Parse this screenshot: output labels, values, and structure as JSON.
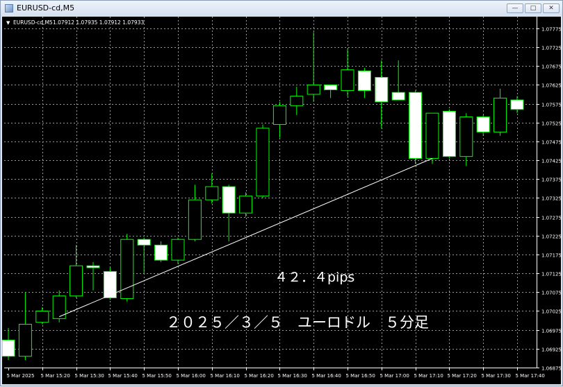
{
  "window": {
    "title": "EURUSD-cd,M5",
    "buttons": {
      "minimize": "—",
      "maximize": "□",
      "close": "✕"
    }
  },
  "chart_info": {
    "marker": "▼",
    "symbol": "EURUSD-cd,M5",
    "ohlc": "1.07912 1.07935 1.07912 1.07933"
  },
  "colors": {
    "background": "#000000",
    "grid": "#9a9a9a",
    "bull_body": "#000000",
    "bear_body": "#ffffff",
    "candle_outline": "#00ff00",
    "trend_line": "#ffffff",
    "text": "#ffffff"
  },
  "annotations": {
    "pips": "４２．４pips",
    "caption": "２０２５／３／５　ユーロドル　５分足"
  },
  "chart_data": {
    "type": "candlestick",
    "ylim": [
      1.06875,
      1.07795
    ],
    "yticks": [
      1.07775,
      1.07725,
      1.07675,
      1.07625,
      1.07575,
      1.07525,
      1.07475,
      1.07425,
      1.07375,
      1.07325,
      1.07275,
      1.07225,
      1.07175,
      1.07125,
      1.07075,
      1.07025,
      1.06975,
      1.06925,
      1.06875
    ],
    "ytick_labels": [
      "1.07775",
      "1.07725",
      "1.07675",
      "1.07625",
      "1.07575",
      "1.07525",
      "1.07475",
      "1.07425",
      "1.07375",
      "1.07325",
      "1.07275",
      "1.07225",
      "1.07175",
      "1.07125",
      "1.07075",
      "1.07025",
      "1.06975",
      "1.06925",
      "1.06875"
    ],
    "xtick_labels": [
      "5 Mar 2025",
      "5 Mar 15:20",
      "5 Mar 15:30",
      "5 Mar 15:40",
      "5 Mar 15:50",
      "5 Mar 16:00",
      "5 Mar 16:10",
      "5 Mar 16:20",
      "5 Mar 16:30",
      "5 Mar 16:40",
      "5 Mar 16:50",
      "5 Mar 17:00",
      "5 Mar 17:10",
      "5 Mar 17:20",
      "5 Mar 17:30",
      "5 Mar 17:40"
    ],
    "candles": [
      {
        "o": 1.06948,
        "h": 1.0698,
        "l": 1.06895,
        "c": 1.06905
      },
      {
        "o": 1.06905,
        "h": 1.07075,
        "l": 1.06895,
        "c": 1.0699
      },
      {
        "o": 1.06995,
        "h": 1.07035,
        "l": 1.0699,
        "c": 1.07025
      },
      {
        "o": 1.07005,
        "h": 1.0708,
        "l": 1.06995,
        "c": 1.07065
      },
      {
        "o": 1.07065,
        "h": 1.072,
        "l": 1.0706,
        "c": 1.07145
      },
      {
        "o": 1.07145,
        "h": 1.07155,
        "l": 1.0708,
        "c": 1.0714
      },
      {
        "o": 1.0713,
        "h": 1.0714,
        "l": 1.07055,
        "c": 1.0706
      },
      {
        "o": 1.07058,
        "h": 1.0723,
        "l": 1.0705,
        "c": 1.07215
      },
      {
        "o": 1.07215,
        "h": 1.0722,
        "l": 1.07125,
        "c": 1.072
      },
      {
        "o": 1.072,
        "h": 1.0721,
        "l": 1.07155,
        "c": 1.0716
      },
      {
        "o": 1.0716,
        "h": 1.0722,
        "l": 1.0715,
        "c": 1.07215
      },
      {
        "o": 1.07215,
        "h": 1.0736,
        "l": 1.0721,
        "c": 1.0732
      },
      {
        "o": 1.0732,
        "h": 1.0739,
        "l": 1.0731,
        "c": 1.07355
      },
      {
        "o": 1.07355,
        "h": 1.0736,
        "l": 1.0721,
        "c": 1.07285
      },
      {
        "o": 1.07285,
        "h": 1.0734,
        "l": 1.07275,
        "c": 1.0733
      },
      {
        "o": 1.0733,
        "h": 1.0752,
        "l": 1.07325,
        "c": 1.0751
      },
      {
        "o": 1.0752,
        "h": 1.0758,
        "l": 1.07485,
        "c": 1.0757
      },
      {
        "o": 1.0757,
        "h": 1.0762,
        "l": 1.07545,
        "c": 1.07595
      },
      {
        "o": 1.076,
        "h": 1.07765,
        "l": 1.0758,
        "c": 1.07625
      },
      {
        "o": 1.07625,
        "h": 1.0762,
        "l": 1.0759,
        "c": 1.07612
      },
      {
        "o": 1.0761,
        "h": 1.0772,
        "l": 1.07595,
        "c": 1.07665
      },
      {
        "o": 1.07662,
        "h": 1.0767,
        "l": 1.0759,
        "c": 1.0761
      },
      {
        "o": 1.07645,
        "h": 1.0769,
        "l": 1.0751,
        "c": 1.0758
      },
      {
        "o": 1.07605,
        "h": 1.0769,
        "l": 1.07585,
        "c": 1.07585
      },
      {
        "o": 1.07605,
        "h": 1.0761,
        "l": 1.07415,
        "c": 1.0743
      },
      {
        "o": 1.0743,
        "h": 1.0755,
        "l": 1.07415,
        "c": 1.0755
      },
      {
        "o": 1.07555,
        "h": 1.0756,
        "l": 1.0743,
        "c": 1.07435
      },
      {
        "o": 1.07435,
        "h": 1.0755,
        "l": 1.0741,
        "c": 1.0754
      },
      {
        "o": 1.0754,
        "h": 1.07545,
        "l": 1.0749,
        "c": 1.075
      },
      {
        "o": 1.075,
        "h": 1.07615,
        "l": 1.0749,
        "c": 1.0759
      },
      {
        "o": 1.07585,
        "h": 1.07595,
        "l": 1.0755,
        "c": 1.0756
      }
    ],
    "trend_line": {
      "from_candle": 3,
      "from_price": 1.0701,
      "to_candle": 25,
      "to_price": 1.0743
    }
  }
}
